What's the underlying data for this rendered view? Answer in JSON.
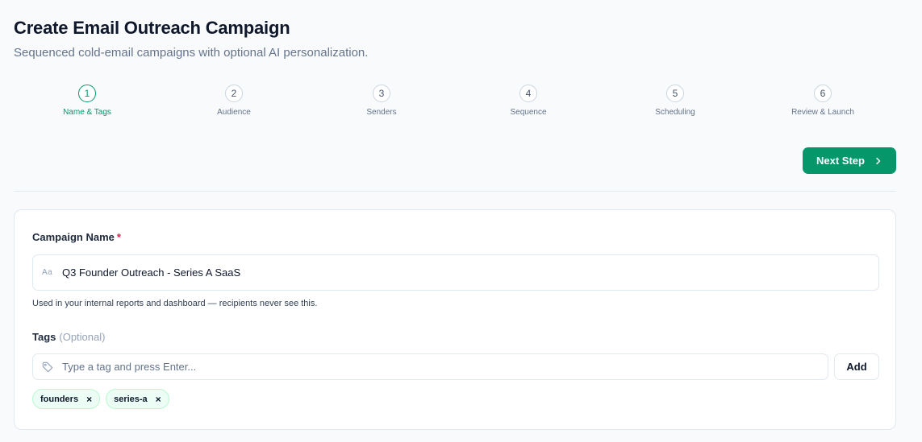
{
  "header": {
    "title": "Create Email Outreach Campaign",
    "subtitle": "Sequenced cold-email campaigns with optional AI personalization."
  },
  "stepper": {
    "active_step": 1,
    "steps": [
      {
        "number": "1",
        "label": "Name & Tags"
      },
      {
        "number": "2",
        "label": "Audience"
      },
      {
        "number": "3",
        "label": "Senders"
      },
      {
        "number": "4",
        "label": "Sequence"
      },
      {
        "number": "5",
        "label": "Scheduling"
      },
      {
        "number": "6",
        "label": "Review & Launch"
      }
    ]
  },
  "actions": {
    "next_label": "Next Step",
    "next_icon": "chevron-right-icon"
  },
  "form": {
    "campaign_name": {
      "label": "Campaign Name",
      "required_mark": "*",
      "icon": "Aa",
      "value": "Q3 Founder Outreach - Series A SaaS",
      "help": "Used in your internal reports and dashboard — recipients never see this."
    },
    "tags": {
      "label": "Tags",
      "optional": "(Optional)",
      "placeholder": "Type a tag and press Enter...",
      "add_label": "Add",
      "items": [
        {
          "label": "founders",
          "remove": "×"
        },
        {
          "label": "series-a",
          "remove": "×"
        }
      ]
    }
  },
  "colors": {
    "accent": "#059669",
    "background": "#f8fafc",
    "required": "#e11d48",
    "chip_bg": "#ecfdf5"
  }
}
